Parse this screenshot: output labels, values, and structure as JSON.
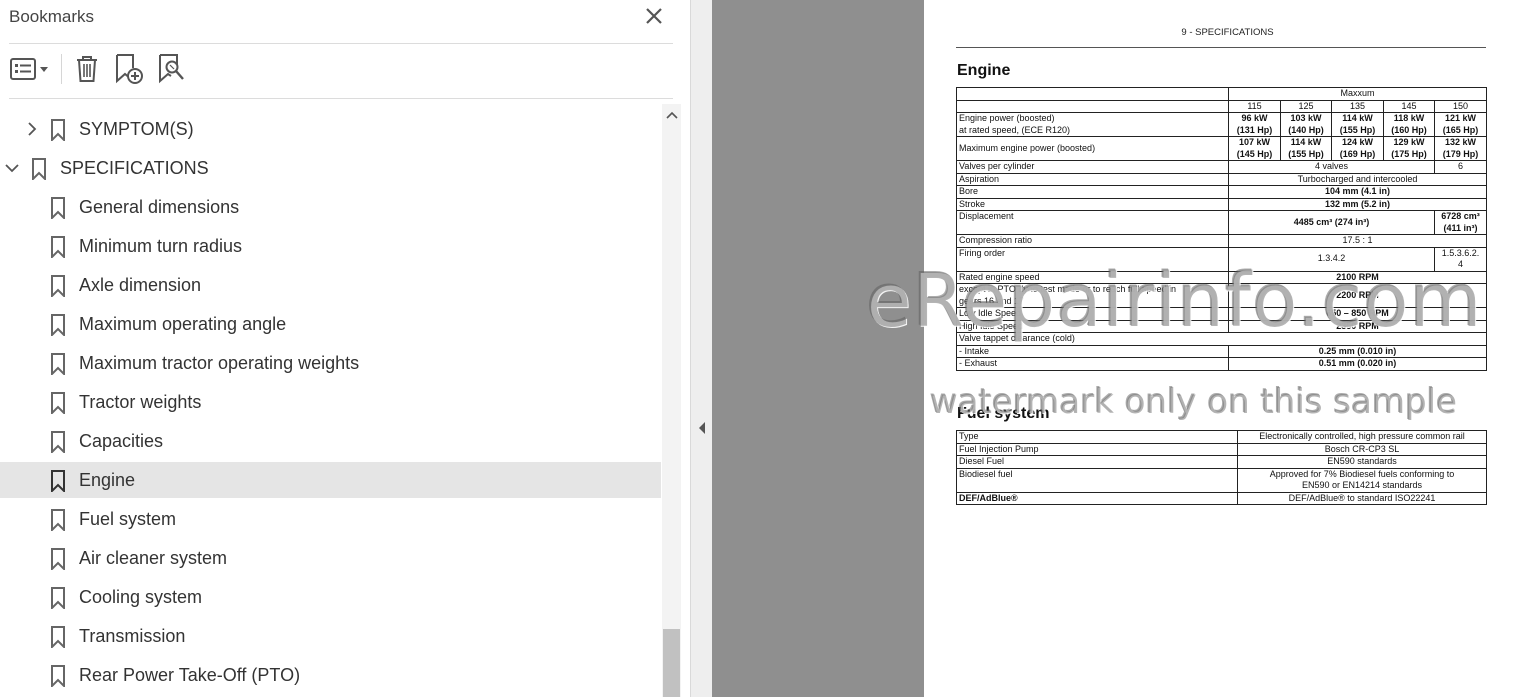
{
  "panel": {
    "title": "Bookmarks"
  },
  "bookmarks": [
    {
      "label": "SYMPTOM(S)",
      "level": 0,
      "expandable": true,
      "expanded": false,
      "selected": false
    },
    {
      "label": "SPECIFICATIONS",
      "level": 0,
      "expandable": true,
      "expanded": true,
      "selected": false
    },
    {
      "label": "General dimensions",
      "level": 1,
      "selected": false
    },
    {
      "label": "Minimum turn radius",
      "level": 1,
      "selected": false
    },
    {
      "label": "Axle dimension",
      "level": 1,
      "selected": false
    },
    {
      "label": "Maximum operating angle",
      "level": 1,
      "selected": false
    },
    {
      "label": "Maximum tractor operating weights",
      "level": 1,
      "selected": false
    },
    {
      "label": "Tractor weights",
      "level": 1,
      "selected": false
    },
    {
      "label": "Capacities",
      "level": 1,
      "selected": false
    },
    {
      "label": "Engine",
      "level": 1,
      "selected": true
    },
    {
      "label": "Fuel system",
      "level": 1,
      "selected": false
    },
    {
      "label": "Air cleaner system",
      "level": 1,
      "selected": false
    },
    {
      "label": "Cooling system",
      "level": 1,
      "selected": false
    },
    {
      "label": "Transmission",
      "level": 1,
      "selected": false
    },
    {
      "label": "Rear Power Take-Off (PTO)",
      "level": 1,
      "selected": false
    }
  ],
  "document": {
    "page_header": "9 - SPECIFICATIONS",
    "engine_title": "Engine",
    "engine_table": {
      "model_header": "Maxxum",
      "models": [
        "115",
        "125",
        "135",
        "145",
        "150"
      ],
      "engine_power": {
        "label_1": "Engine power (boosted)",
        "label_2": "at rated speed, (ECE R120)",
        "values": [
          [
            "96 kW",
            "(131 Hp)"
          ],
          [
            "103 kW",
            "(140 Hp)"
          ],
          [
            "114 kW",
            "(155 Hp)"
          ],
          [
            "118 kW",
            "(160 Hp)"
          ],
          [
            "121 kW",
            "(165 Hp)"
          ]
        ]
      },
      "max_power": {
        "label": "Maximum engine power (boosted)",
        "values": [
          [
            "107 kW",
            "(145 Hp)"
          ],
          [
            "114 kW",
            "(155 Hp)"
          ],
          [
            "124 kW",
            "(169 Hp)"
          ],
          [
            "129 kW",
            "(175 Hp)"
          ],
          [
            "132 kW",
            "(179 Hp)"
          ]
        ]
      },
      "valves": {
        "label": "Valves per cylinder",
        "value": "4 valves",
        "value_150": "6"
      },
      "aspiration": {
        "label": "Aspiration",
        "value": "Turbocharged and intercooled"
      },
      "bore": {
        "label": "Bore",
        "value": "104 mm (4.1 in)"
      },
      "stroke": {
        "label": "Stroke",
        "value": "132 mm (5.2 in)"
      },
      "displacement": {
        "label": "Displacement",
        "value": "4485 cm³ (274 in³)",
        "value_150_1": "6728 cm³",
        "value_150_2": "(411 in³)"
      },
      "compression": {
        "label": "Compression ratio",
        "value": "17.5 : 1"
      },
      "firing": {
        "label": "Firing order",
        "value": "1.3.4.2",
        "value_150_1": "1.5.3.6.2.",
        "value_150_2": "4"
      },
      "rated_speed": {
        "label": "Rated engine speed",
        "value": "2100 RPM"
      },
      "pto_speed": {
        "label_1": "except in PTO dyno test mode or to reach full speed in",
        "label_2": "gears 16 and 17",
        "value": "2200 RPM"
      },
      "low_idle": {
        "label": "Low Idle Speed",
        "value": "650 – 850 RPM"
      },
      "high_idle": {
        "label": "High Idle Speed",
        "value": "2350 RPM"
      },
      "tappet": {
        "label": "Valve tappet clearance (cold)"
      },
      "intake": {
        "label": "- Intake",
        "value": "0.25 mm (0.010 in)"
      },
      "exhaust": {
        "label": "- Exhaust",
        "value": "0.51 mm (0.020 in)"
      }
    },
    "fuel_title": "Fuel system",
    "fuel_table": {
      "type": {
        "label": "Type",
        "value": "Electronically controlled, high pressure common rail"
      },
      "pump": {
        "label": "Fuel Injection Pump",
        "value": "Bosch CR-CP3 SL"
      },
      "diesel": {
        "label": "Diesel Fuel",
        "value": "EN590 standards"
      },
      "biodiesel": {
        "label": "Biodiesel fuel",
        "value_1": "Approved for 7% Biodiesel fuels conforming to",
        "value_2": "EN590 or EN14214 standards"
      },
      "def": {
        "label": "DEF/AdBlue®",
        "value": "DEF/AdBlue® to standard ISO22241"
      }
    },
    "watermark_1": "eRepairinfo.com",
    "watermark_2": "watermark only on this sample"
  }
}
